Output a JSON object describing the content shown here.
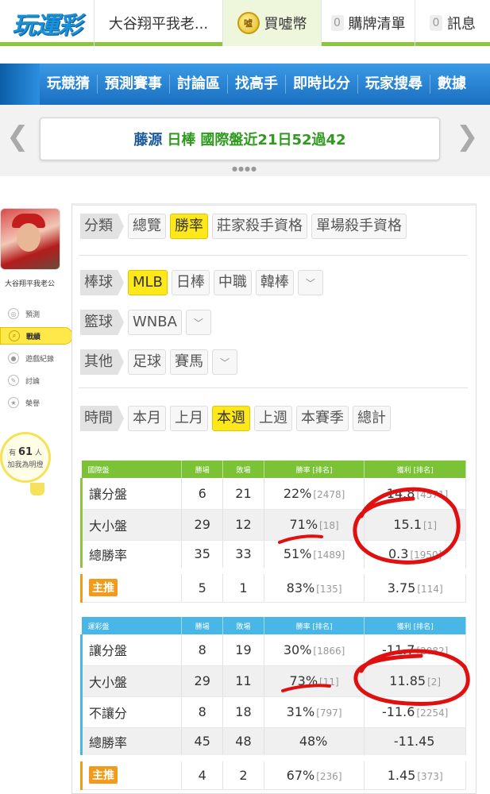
{
  "header": {
    "logo": "玩運彩",
    "user": "大谷翔平我老...",
    "coins_label": "買噓幣",
    "coin_icon_text": "噓",
    "cart_count": "0",
    "cart_label": "購牌清單",
    "msg_count": "0",
    "msg_label": "訊息"
  },
  "nav": {
    "items": [
      "玩競猜",
      "預測賽事",
      "討論區",
      "找高手",
      "即時比分",
      "玩家搜尋",
      "數據"
    ]
  },
  "banner": {
    "name": "藤源",
    "league": "日棒",
    "text": "國際盤近21日52過42",
    "dots": "●●●●"
  },
  "sidebar": {
    "username": "大谷翔平我老公",
    "items": [
      "預測",
      "戰績",
      "遊戲紀錄",
      "討論",
      "榮譽"
    ],
    "active_index": 1,
    "bulb_prefix": "有",
    "bulb_count": "61",
    "bulb_suffix": "人",
    "bulb_line2": "加我為明燈"
  },
  "filters": {
    "category": {
      "label": "分類",
      "options": [
        "總覽",
        "勝率",
        "莊家殺手資格",
        "單場殺手資格"
      ],
      "active": "勝率"
    },
    "baseball": {
      "label": "棒球",
      "options": [
        "MLB",
        "日棒",
        "中職",
        "韓棒"
      ],
      "active": "MLB"
    },
    "basketball": {
      "label": "籃球",
      "options": [
        "WNBA"
      ]
    },
    "other": {
      "label": "其他",
      "options": [
        "足球",
        "賽馬"
      ]
    },
    "time": {
      "label": "時間",
      "options": [
        "本月",
        "上月",
        "本週",
        "上週",
        "本賽季",
        "總計"
      ],
      "active": "本週"
    }
  },
  "intl_table": {
    "headers": [
      "國際盤",
      "勝場",
      "敗場",
      "勝率 [排名]",
      "獲利 [排名]"
    ],
    "rows": [
      {
        "name": "讓分盤",
        "win": "6",
        "lose": "21",
        "rate": "22%",
        "rate_rank": "[2478]",
        "profit": "-14.8",
        "profit_rank": "[4571]"
      },
      {
        "name": "大小盤",
        "win": "29",
        "lose": "12",
        "rate": "71%",
        "rate_rank": "[18]",
        "profit": "15.1",
        "profit_rank": "[1]"
      },
      {
        "name": "總勝率",
        "win": "35",
        "lose": "33",
        "rate": "51%",
        "rate_rank": "[1489]",
        "profit": "0.3",
        "profit_rank": "[1950]"
      }
    ],
    "push": {
      "name": "主推",
      "win": "5",
      "lose": "1",
      "rate": "83%",
      "rate_rank": "[135]",
      "profit": "3.75",
      "profit_rank": "[114]"
    }
  },
  "sport_table": {
    "headers": [
      "運彩盤",
      "勝場",
      "敗場",
      "勝率 [排名]",
      "獲利 [排名]"
    ],
    "rows": [
      {
        "name": "讓分盤",
        "win": "8",
        "lose": "19",
        "rate": "30%",
        "rate_rank": "[1866]",
        "profit": "-11.7",
        "profit_rank": "[2082]"
      },
      {
        "name": "大小盤",
        "win": "29",
        "lose": "11",
        "rate": "73%",
        "rate_rank": "[11]",
        "profit": "11.85",
        "profit_rank": "[2]"
      },
      {
        "name": "不讓分",
        "win": "8",
        "lose": "18",
        "rate": "31%",
        "rate_rank": "[797]",
        "profit": "-11.6",
        "profit_rank": "[2254]"
      },
      {
        "name": "總勝率",
        "win": "45",
        "lose": "48",
        "rate": "48%",
        "rate_rank": "",
        "profit": "-11.45",
        "profit_rank": ""
      }
    ],
    "push": {
      "name": "主推",
      "win": "4",
      "lose": "2",
      "rate": "67%",
      "rate_rank": "[236]",
      "profit": "1.45",
      "profit_rank": "[373]"
    }
  },
  "colors": {
    "accent_green": "#8cc63f",
    "accent_blue": "#48b7e8",
    "nav_blue": "#1a6fc0",
    "highlight_yellow": "#ffe81a",
    "annotation_red": "#e01010"
  }
}
